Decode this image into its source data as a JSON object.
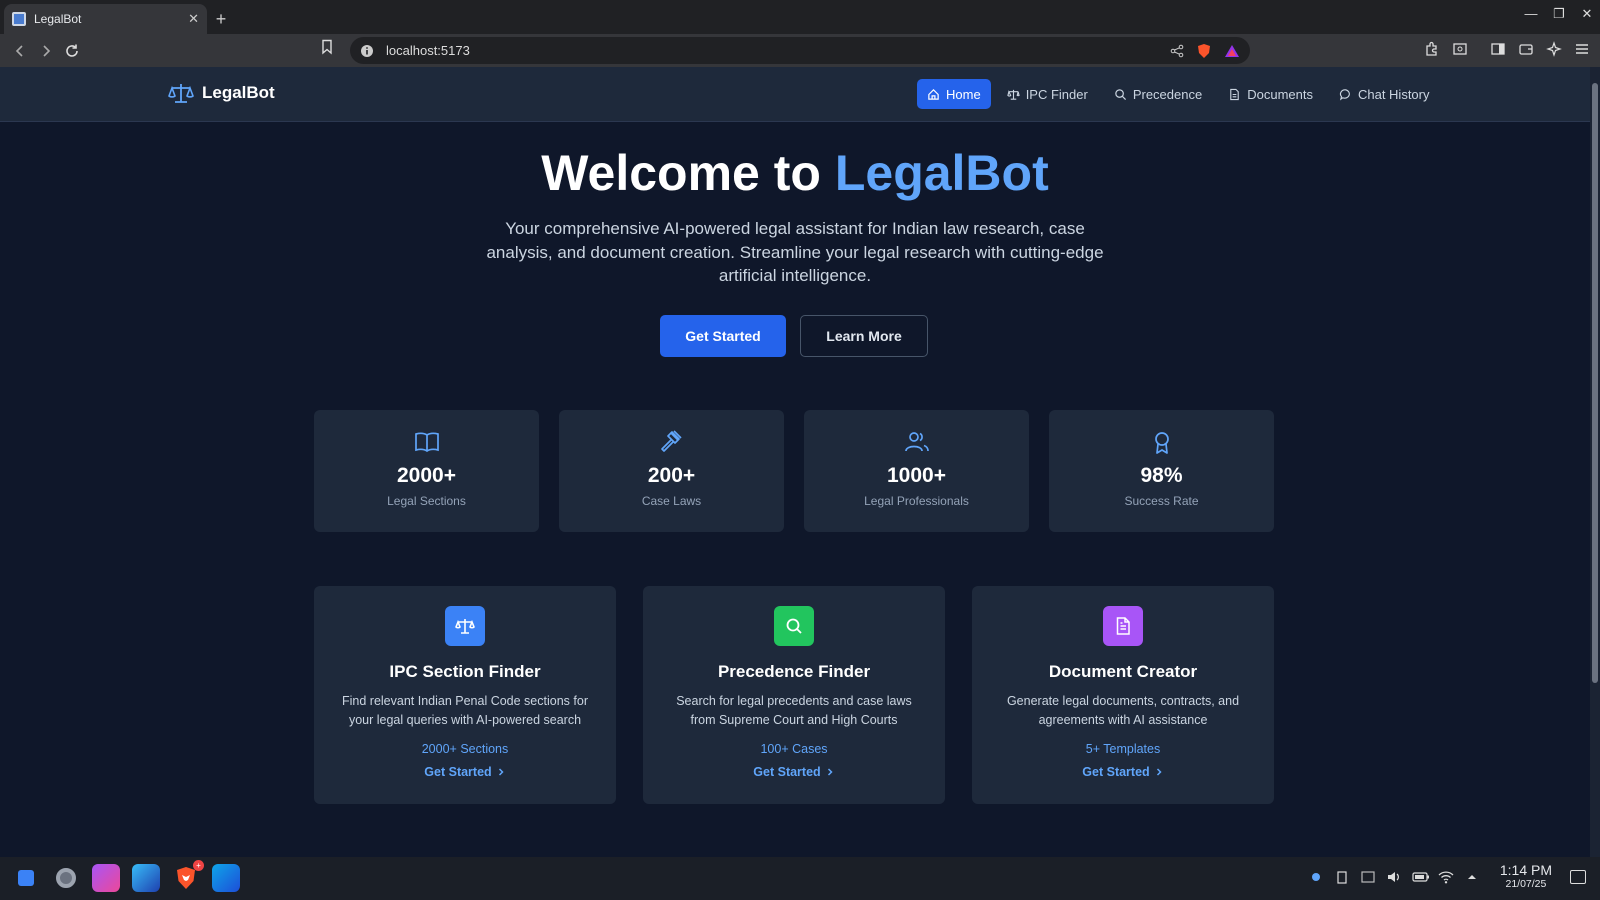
{
  "browser": {
    "tab_title": "LegalBot",
    "tab_close": "✕",
    "new_tab": "+",
    "url": "localhost:5173"
  },
  "app": {
    "brand": "LegalBot",
    "nav": [
      {
        "label": "Home",
        "icon": "home-icon",
        "active": true
      },
      {
        "label": "IPC Finder",
        "icon": "scale-icon",
        "active": false
      },
      {
        "label": "Precedence",
        "icon": "search-icon",
        "active": false
      },
      {
        "label": "Documents",
        "icon": "document-icon",
        "active": false
      },
      {
        "label": "Chat History",
        "icon": "chat-icon",
        "active": false
      }
    ]
  },
  "hero": {
    "title_prefix": "Welcome to ",
    "title_accent": "LegalBot",
    "subtitle": "Your comprehensive AI-powered legal assistant for Indian law research, case analysis, and document creation. Streamline your legal research with cutting-edge artificial intelligence.",
    "primary_button": "Get Started",
    "secondary_button": "Learn More"
  },
  "stats": [
    {
      "value": "2000+",
      "label": "Legal Sections",
      "icon": "book-icon"
    },
    {
      "value": "200+",
      "label": "Case Laws",
      "icon": "gavel-icon"
    },
    {
      "value": "1000+",
      "label": "Legal Professionals",
      "icon": "users-icon"
    },
    {
      "value": "98%",
      "label": "Success Rate",
      "icon": "award-icon"
    }
  ],
  "features": [
    {
      "title": "IPC Section Finder",
      "description": "Find relevant Indian Penal Code sections for your legal queries with AI-powered search",
      "stat": "2000+ Sections",
      "cta": "Get Started",
      "icon": "scale-icon",
      "color": "#3b82f6"
    },
    {
      "title": "Precedence Finder",
      "description": "Search for legal precedents and case laws from Supreme Court and High Courts",
      "stat": "100+ Cases",
      "cta": "Get Started",
      "icon": "search-icon",
      "color": "#22c55e"
    },
    {
      "title": "Document Creator",
      "description": "Generate legal documents, contracts, and agreements with AI assistance",
      "stat": "5+ Templates",
      "cta": "Get Started",
      "icon": "document-icon",
      "color": "#a855f7"
    }
  ],
  "taskbar": {
    "time": "1:14 PM",
    "date": "21/07/25",
    "brave_badge": "+"
  },
  "colors": {
    "accent": "#2563eb",
    "accent_light": "#60a5fa",
    "background": "#0f172a",
    "card": "#1e293b"
  }
}
